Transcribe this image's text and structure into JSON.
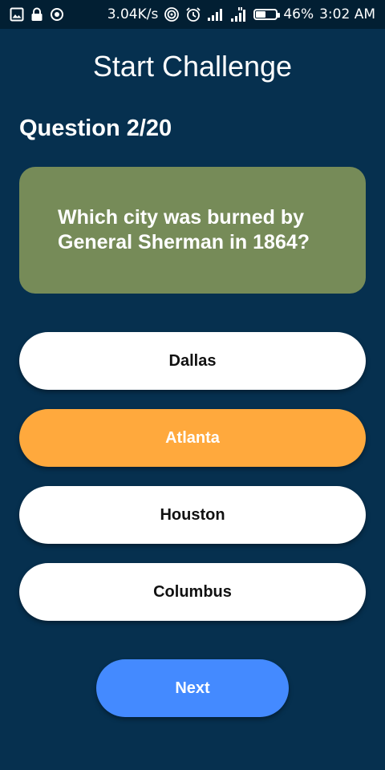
{
  "status_bar": {
    "net_speed": "3.04K/s",
    "battery_percent": "46%",
    "battery_level": 0.46,
    "time": "3:02 AM",
    "left_icons": [
      "image-icon",
      "lock-icon",
      "target-icon"
    ],
    "right_icons": [
      "hotspot-icon",
      "alarm-icon",
      "signal-icon",
      "signal-4g-icon",
      "battery-icon"
    ]
  },
  "header": {
    "title": "Start Challenge"
  },
  "quiz": {
    "counter": "Question 2/20",
    "question": "Which city was burned by General Sherman in 1864?",
    "answers": [
      {
        "label": "Dallas",
        "selected": false
      },
      {
        "label": "Atlanta",
        "selected": true
      },
      {
        "label": "Houston",
        "selected": false
      },
      {
        "label": "Columbus",
        "selected": false
      }
    ],
    "next_label": "Next"
  },
  "colors": {
    "background": "#06304f",
    "status_bar": "#021f33",
    "question_card": "#768b58",
    "selected_answer": "#ffa93d",
    "next_button": "#448aff"
  }
}
